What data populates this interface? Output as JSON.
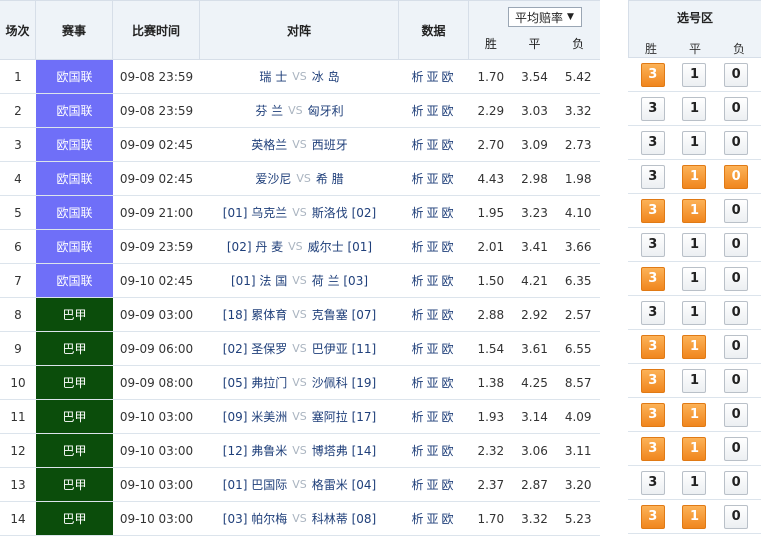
{
  "header": {
    "num": "场次",
    "league": "赛事",
    "time": "比赛时间",
    "match": "对阵",
    "data": "数据",
    "odds_select": "平均赔率",
    "win": "胜",
    "draw": "平",
    "lose": "负",
    "pick_title": "选号区"
  },
  "colors": {
    "uefa": "#6f6ff8",
    "brazil": "#0b4d0b",
    "selected": "#f0861e"
  },
  "rows": [
    {
      "num": "1",
      "league": "欧国联",
      "league_type": "uefa",
      "time": "09-08 23:59",
      "home": "瑞 士",
      "away": "冰 岛",
      "data": "析亚欧",
      "w": "1.70",
      "d": "3.54",
      "l": "5.42",
      "sel": [
        true,
        false,
        false
      ]
    },
    {
      "num": "2",
      "league": "欧国联",
      "league_type": "uefa",
      "time": "09-08 23:59",
      "home": "芬 兰",
      "away": "匈牙利",
      "data": "析亚欧",
      "w": "2.29",
      "d": "3.03",
      "l": "3.32",
      "sel": [
        false,
        false,
        false
      ]
    },
    {
      "num": "3",
      "league": "欧国联",
      "league_type": "uefa",
      "time": "09-09 02:45",
      "home": "英格兰",
      "away": "西班牙",
      "data": "析亚欧",
      "w": "2.70",
      "d": "3.09",
      "l": "2.73",
      "sel": [
        false,
        false,
        false
      ]
    },
    {
      "num": "4",
      "league": "欧国联",
      "league_type": "uefa",
      "time": "09-09 02:45",
      "home": "爱沙尼",
      "away": "希 腊",
      "data": "析亚欧",
      "w": "4.43",
      "d": "2.98",
      "l": "1.98",
      "sel": [
        false,
        true,
        true
      ]
    },
    {
      "num": "5",
      "league": "欧国联",
      "league_type": "uefa",
      "time": "09-09 21:00",
      "home": "[01] 乌克兰",
      "away": "斯洛伐 [02]",
      "data": "析亚欧",
      "w": "1.95",
      "d": "3.23",
      "l": "4.10",
      "sel": [
        true,
        true,
        false
      ]
    },
    {
      "num": "6",
      "league": "欧国联",
      "league_type": "uefa",
      "time": "09-09 23:59",
      "home": "[02] 丹 麦",
      "away": "威尔士 [01]",
      "data": "析亚欧",
      "w": "2.01",
      "d": "3.41",
      "l": "3.66",
      "sel": [
        false,
        false,
        false
      ]
    },
    {
      "num": "7",
      "league": "欧国联",
      "league_type": "uefa",
      "time": "09-10 02:45",
      "home": "[01] 法 国",
      "away": "荷 兰 [03]",
      "data": "析亚欧",
      "w": "1.50",
      "d": "4.21",
      "l": "6.35",
      "sel": [
        true,
        false,
        false
      ]
    },
    {
      "num": "8",
      "league": "巴甲",
      "league_type": "brazil",
      "time": "09-09 03:00",
      "home": "[18] 累体育",
      "away": "克鲁塞 [07]",
      "data": "析亚欧",
      "w": "2.88",
      "d": "2.92",
      "l": "2.57",
      "sel": [
        false,
        false,
        false
      ]
    },
    {
      "num": "9",
      "league": "巴甲",
      "league_type": "brazil",
      "time": "09-09 06:00",
      "home": "[02] 圣保罗",
      "away": "巴伊亚 [11]",
      "data": "析亚欧",
      "w": "1.54",
      "d": "3.61",
      "l": "6.55",
      "sel": [
        true,
        true,
        false
      ]
    },
    {
      "num": "10",
      "league": "巴甲",
      "league_type": "brazil",
      "time": "09-09 08:00",
      "home": "[05] 弗拉门",
      "away": "沙佩科 [19]",
      "data": "析亚欧",
      "w": "1.38",
      "d": "4.25",
      "l": "8.57",
      "sel": [
        true,
        false,
        false
      ]
    },
    {
      "num": "11",
      "league": "巴甲",
      "league_type": "brazil",
      "time": "09-10 03:00",
      "home": "[09] 米美洲",
      "away": "塞阿拉 [17]",
      "data": "析亚欧",
      "w": "1.93",
      "d": "3.14",
      "l": "4.09",
      "sel": [
        true,
        true,
        false
      ]
    },
    {
      "num": "12",
      "league": "巴甲",
      "league_type": "brazil",
      "time": "09-10 03:00",
      "home": "[12] 弗鲁米",
      "away": "博塔弗 [14]",
      "data": "析亚欧",
      "w": "2.32",
      "d": "3.06",
      "l": "3.11",
      "sel": [
        true,
        true,
        false
      ]
    },
    {
      "num": "13",
      "league": "巴甲",
      "league_type": "brazil",
      "time": "09-10 03:00",
      "home": "[01] 巴国际",
      "away": "格雷米 [04]",
      "data": "析亚欧",
      "w": "2.37",
      "d": "2.87",
      "l": "3.20",
      "sel": [
        false,
        false,
        false
      ]
    },
    {
      "num": "14",
      "league": "巴甲",
      "league_type": "brazil",
      "time": "09-10 03:00",
      "home": "[03] 帕尔梅",
      "away": "科林蒂 [08]",
      "data": "析亚欧",
      "w": "1.70",
      "d": "3.32",
      "l": "5.23",
      "sel": [
        true,
        true,
        false
      ]
    }
  ],
  "pick_labels": [
    "3",
    "1",
    "0"
  ],
  "vs_label": "VS"
}
